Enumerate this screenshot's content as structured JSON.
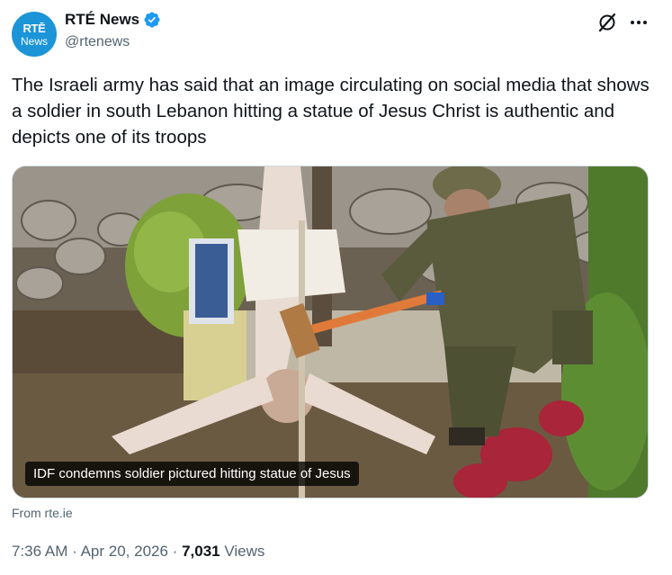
{
  "account": {
    "avatar_line1": "RTĒ",
    "avatar_line2": "News",
    "display_name": "RTÉ News",
    "handle": "@rtenews",
    "verified": true,
    "avatar_color": "#1b95d8",
    "verified_color": "#1d9bf0"
  },
  "header_icons": [
    "grok-icon",
    "more-options-icon"
  ],
  "tweet": {
    "text": "The Israeli army has said that an image circulating on social media that shows a soldier in south Lebanon hitting a statue of Jesus Christ is authentic and depicts one of its troops"
  },
  "media": {
    "caption": "IDF condemns soldier pictured hitting statue of Jesus",
    "source": "From rte.ie"
  },
  "meta": {
    "time": "7:36 AM",
    "date": "Apr 20, 2026",
    "separator": "·",
    "views_count": "7,031",
    "views_label": "Views"
  }
}
